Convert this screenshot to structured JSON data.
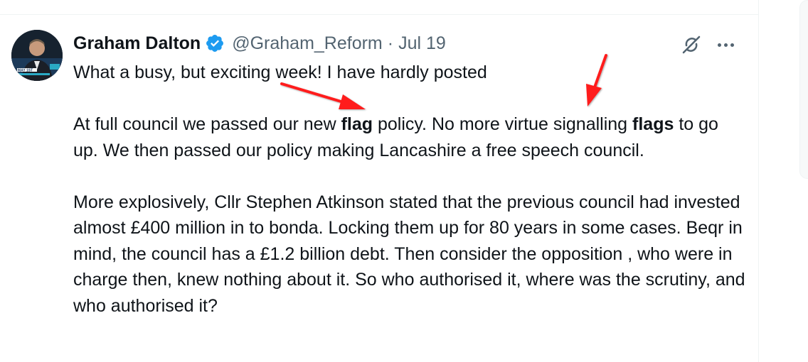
{
  "tweet": {
    "author": {
      "display_name": "Graham Dalton",
      "handle": "@Graham_Reform",
      "verified": true,
      "avatar_badge": "MAY 1ST"
    },
    "separator": "·",
    "date": "Jul 19",
    "body": {
      "p1": "What a busy, but exciting week! I have hardly posted",
      "p2_a": "At full council we passed our new ",
      "p2_flag": "flag",
      "p2_b": " policy. No more virtue signalling ",
      "p2_flags": "flags",
      "p2_c": " to go up.  We then passed our policy making Lancashire a free speech council.",
      "p3": "More explosively, Cllr Stephen Atkinson stated that the previous council had invested almost £400 million in to bonda. Locking them up for 80 years in some cases. Beqr in mind, the council has a £1.2 billion debt. Then consider the opposition , who were in charge then, knew nothing about it. So who authorised it, where was the scrutiny, and who authorised it?"
    }
  },
  "icons": {
    "verified": "verified-badge-icon",
    "grok": "grok-icon",
    "more": "more-options-icon"
  },
  "colors": {
    "text": "#0f1419",
    "secondary": "#536471",
    "verified": "#1d9bf0",
    "annotation_arrow": "#ff1a1a"
  }
}
